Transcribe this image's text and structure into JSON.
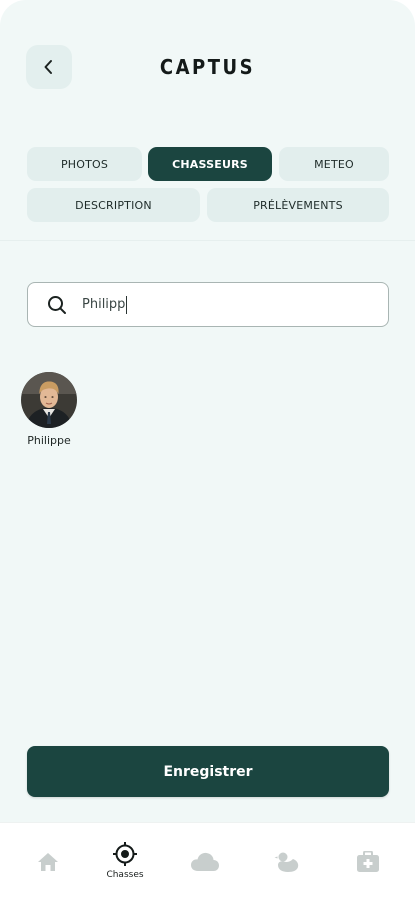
{
  "header": {
    "title": "CAPTUS",
    "back_icon": "chevron-left-icon"
  },
  "tabs": [
    {
      "label": "PHOTOS",
      "active": false
    },
    {
      "label": "CHASSEURS",
      "active": true
    },
    {
      "label": "METEO",
      "active": false
    },
    {
      "label": "DESCRIPTION",
      "active": false
    },
    {
      "label": "PRÉLÈVEMENTS",
      "active": false
    }
  ],
  "search": {
    "value": "Philipp",
    "icon": "search-icon"
  },
  "results": [
    {
      "name": "Philippe",
      "avatar": "person-photo"
    }
  ],
  "actions": {
    "save_label": "Enregistrer"
  },
  "bottom_nav": {
    "items": [
      {
        "icon": "home-icon",
        "label": "",
        "active": false
      },
      {
        "icon": "target-icon",
        "label": "Chasses",
        "active": true
      },
      {
        "icon": "cloud-icon",
        "label": "",
        "active": false
      },
      {
        "icon": "duck-icon",
        "label": "",
        "active": false
      },
      {
        "icon": "medical-kit-icon",
        "label": "",
        "active": false
      }
    ]
  },
  "colors": {
    "primary": "#1b4540",
    "background": "#f1f8f7",
    "tab_inactive": "#e2eeed",
    "nav_inactive_icon": "#c8cecd"
  }
}
